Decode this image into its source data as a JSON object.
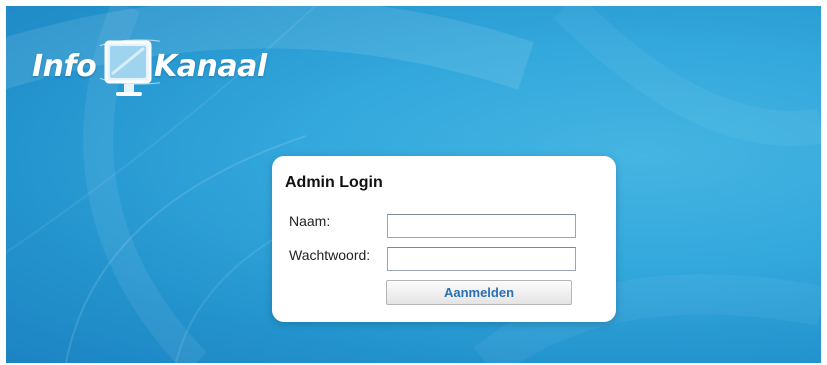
{
  "logo": {
    "word1": "Info",
    "word2": "Kanaal",
    "icon": "monitor-icon"
  },
  "login": {
    "title": "Admin Login",
    "username_label": "Naam:",
    "username_value": "",
    "password_label": "Wachtwoord:",
    "password_value": "",
    "submit_label": "Aanmelden"
  },
  "colors": {
    "background_blue": "#33a8dc",
    "button_text": "#2a6fb3"
  }
}
